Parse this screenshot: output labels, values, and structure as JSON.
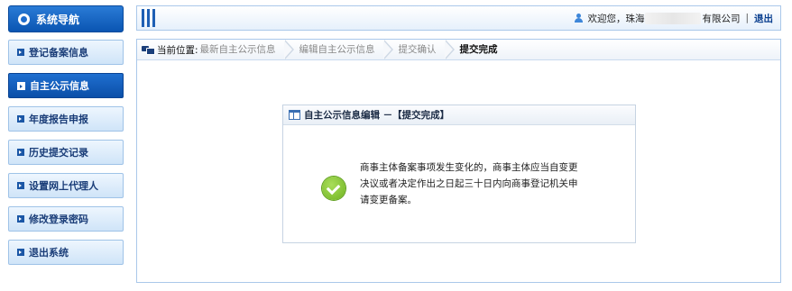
{
  "sidebar": {
    "title": "系统导航",
    "items": [
      {
        "label": "登记备案信息",
        "active": false
      },
      {
        "label": "自主公示信息",
        "active": true
      },
      {
        "label": "年度报告申报",
        "active": false
      },
      {
        "label": "历史提交记录",
        "active": false
      },
      {
        "label": "设置网上代理人",
        "active": false
      },
      {
        "label": "修改登录密码",
        "active": false
      },
      {
        "label": "退出系统",
        "active": false
      }
    ]
  },
  "header": {
    "welcome": "欢迎您，珠海",
    "company_suffix": "有限公司",
    "separator": "|",
    "logout_label": "退出"
  },
  "breadcrumb": {
    "label": "当前位置:",
    "steps": [
      "最新自主公示信息",
      "编辑自主公示信息",
      "提交确认",
      "提交完成"
    ],
    "current_index": 3
  },
  "dialog": {
    "title": "自主公示信息编辑 －【提交完成】",
    "message_lines": [
      "商事主体备案事项发生变化的，商事主体应当自变更",
      "决议或者决定作出之日起三十日内向商事登记机关申",
      "请变更备案。"
    ]
  },
  "colors": {
    "accent": "#0a55b2",
    "nav_text": "#1a3d78",
    "success": "#6fb320"
  }
}
